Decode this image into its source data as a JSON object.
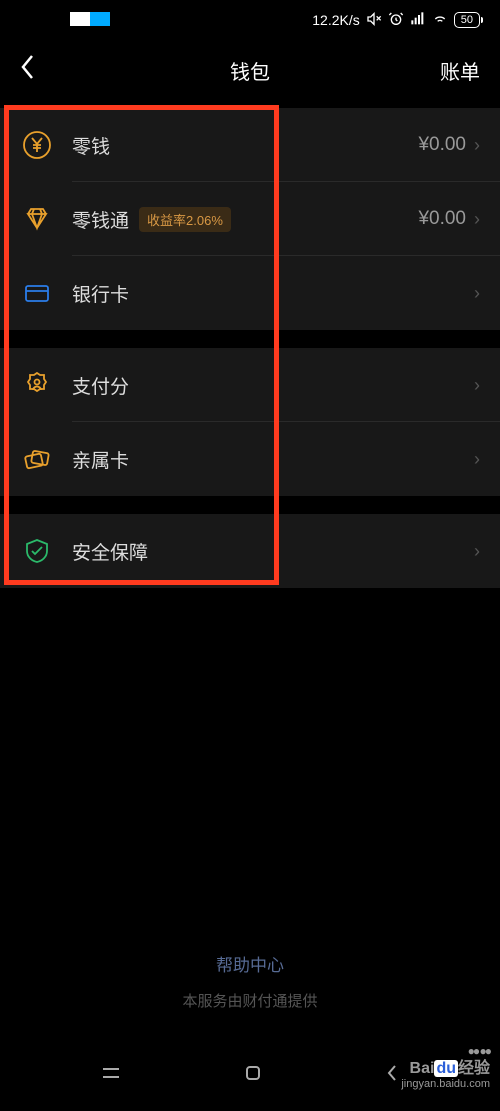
{
  "status": {
    "speed": "12.2K/s",
    "battery": "50"
  },
  "header": {
    "title": "钱包",
    "right": "账单"
  },
  "items": {
    "change": {
      "label": "零钱",
      "value": "¥0.00"
    },
    "changePlus": {
      "label": "零钱通",
      "badge": "收益率2.06%",
      "value": "¥0.00"
    },
    "bankCard": {
      "label": "银行卡"
    },
    "payScore": {
      "label": "支付分"
    },
    "familyCard": {
      "label": "亲属卡"
    },
    "security": {
      "label": "安全保障"
    }
  },
  "footer": {
    "help": "帮助中心",
    "provider": "本服务由财付通提供"
  },
  "watermark": {
    "brand_pre": "Bai",
    "brand_du": "du",
    "brand_post": "经验",
    "url": "jingyan.baidu.com"
  }
}
